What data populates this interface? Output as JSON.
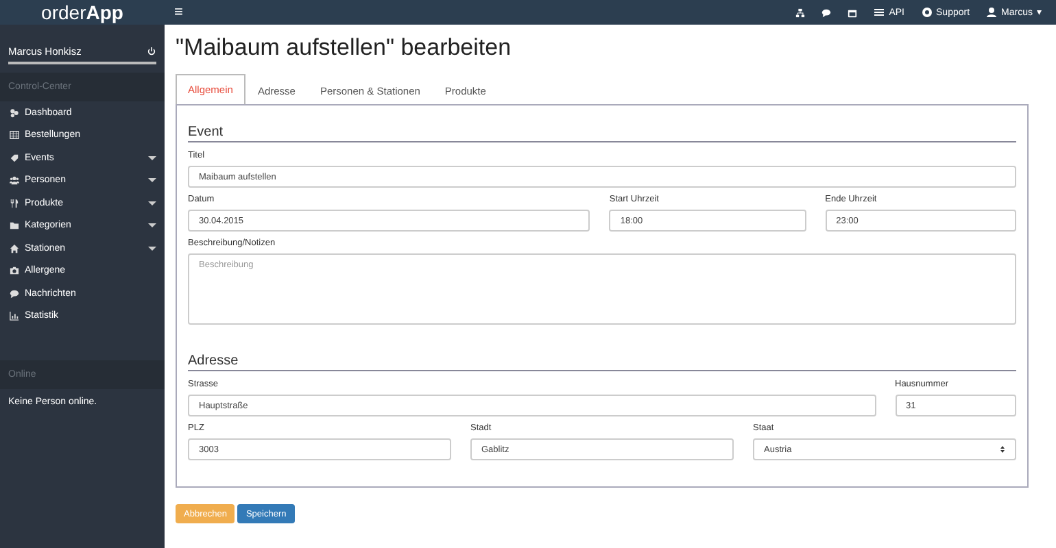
{
  "header": {
    "brand": "order**App**",
    "menu_glyph": "≡",
    "links": [
      {
        "kind": "sitemap"
      },
      {
        "kind": "comment"
      },
      {
        "kind": "calendar"
      },
      {
        "kind": "api",
        "label": "API"
      },
      {
        "kind": "support",
        "label": "Support"
      },
      {
        "kind": "user",
        "label": "Marcus",
        "caret": "▾"
      }
    ]
  },
  "sidebar": {
    "user": "Marcus Honkisz",
    "section": "Control-Center",
    "items": [
      {
        "label": "Dashboard",
        "expandable": false
      },
      {
        "label": "Bestellungen",
        "expandable": false
      },
      {
        "label": "Events",
        "expandable": true
      },
      {
        "label": "Personen",
        "expandable": true
      },
      {
        "label": "Produkte",
        "expandable": true
      },
      {
        "label": "Kategorien",
        "expandable": true
      },
      {
        "label": "Stationen",
        "expandable": true
      },
      {
        "label": "Allergene",
        "expandable": false
      },
      {
        "label": "Nachrichten",
        "expandable": false
      },
      {
        "label": "Statistik",
        "expandable": false
      }
    ],
    "online_title": "Online",
    "online_text": "Keine Person online."
  },
  "page_title": "\"Maibaum aufstellen\" bearbeiten",
  "tabs": [
    {
      "label": "Allgemein",
      "selected": true
    },
    {
      "label": "Adresse",
      "selected": false
    },
    {
      "label": "Personen & Stationen",
      "selected": false
    },
    {
      "label": "Produkte",
      "selected": false
    }
  ],
  "sections": [
    {
      "title": "Event",
      "rows": [
        [
          {
            "kind": "text",
            "label": "Titel",
            "value": "Maibaum aufstellen"
          }
        ],
        [
          {
            "kind": "text",
            "label": "Datum",
            "value": "30.04.2015"
          },
          {
            "kind": "text",
            "label": "Start Uhrzeit",
            "value": "18:00"
          },
          {
            "kind": "text",
            "label": "Ende Uhrzeit",
            "value": "23:00"
          }
        ],
        [
          {
            "kind": "textarea",
            "label": "Beschreibung/Notizen",
            "placeholder": "Beschreibung"
          }
        ]
      ]
    },
    {
      "title": "Adresse",
      "rows": [
        [
          {
            "kind": "text",
            "label": "Strasse",
            "value": "Hauptstraße"
          },
          {
            "kind": "text",
            "label": "Hausnummer",
            "value": "31"
          }
        ],
        [
          {
            "kind": "text",
            "label": "PLZ",
            "value": "3003"
          },
          {
            "kind": "text",
            "label": "Stadt",
            "value": "Gablitz"
          },
          {
            "kind": "select",
            "label": "Staat",
            "value": "Austria"
          }
        ]
      ]
    }
  ],
  "buttons": [
    {
      "kind": "warning",
      "label": "Abbrechen"
    },
    {
      "kind": "primary",
      "label": "Speichern"
    }
  ]
}
